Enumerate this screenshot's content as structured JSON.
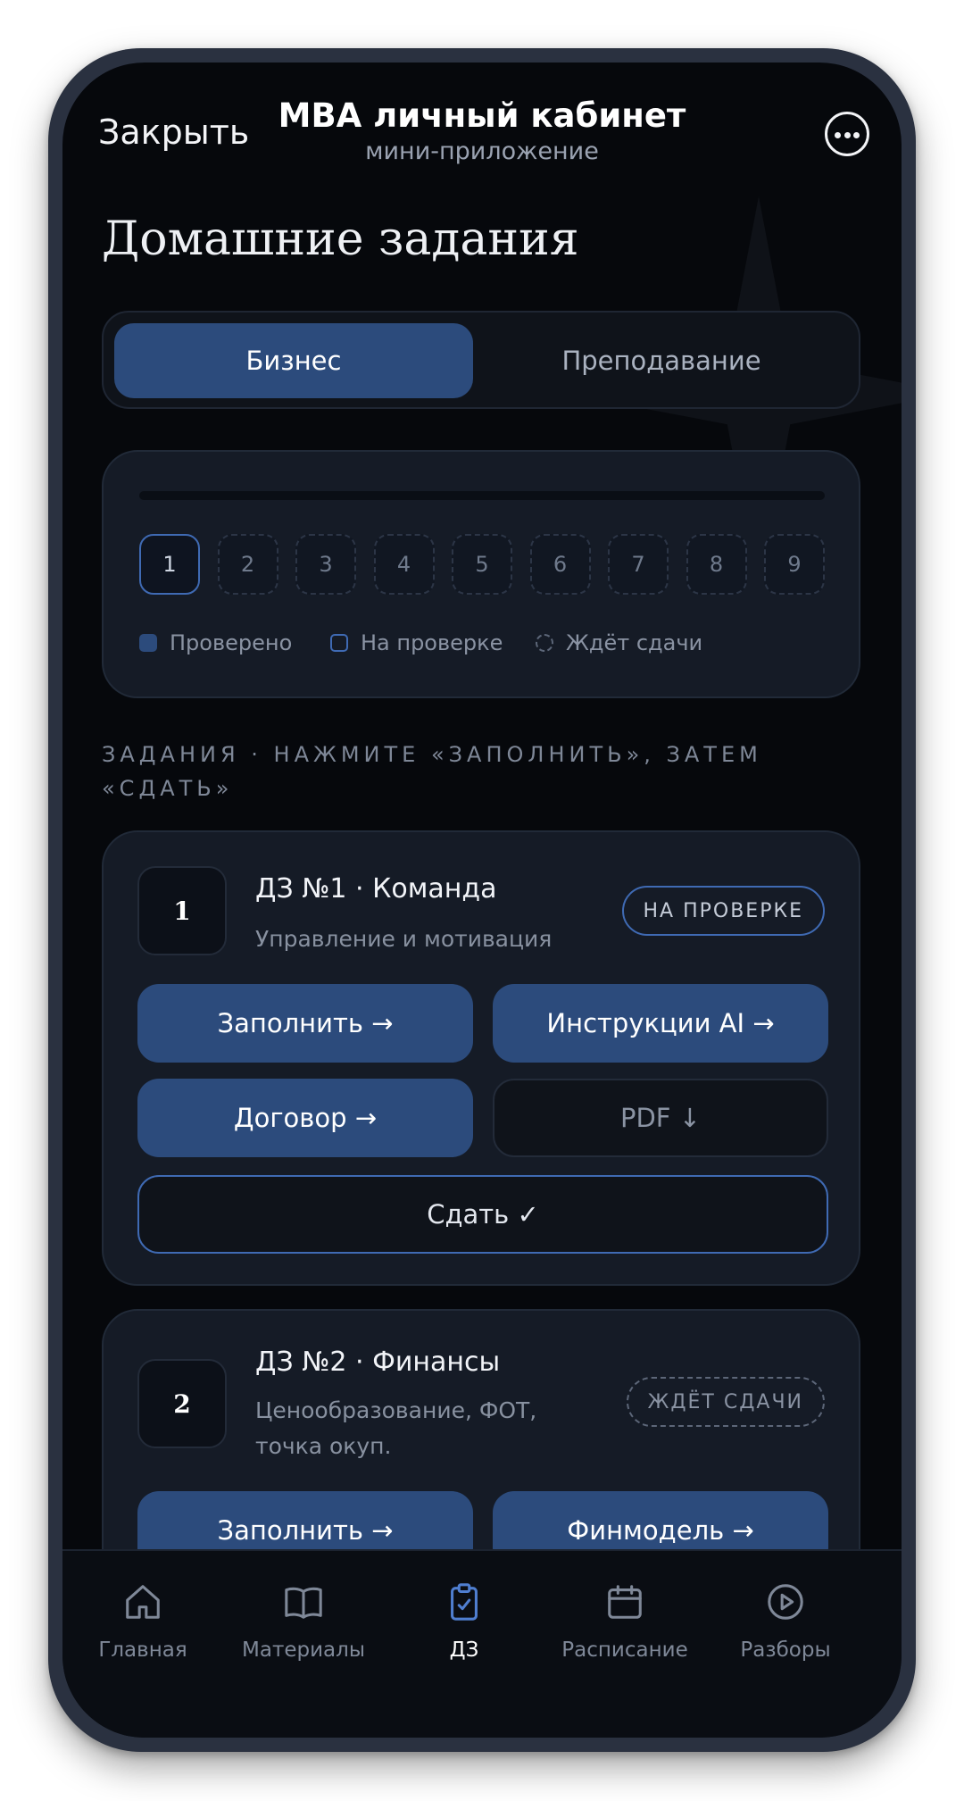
{
  "header": {
    "close_label": "Закрыть",
    "title": "MBA личный кабинет",
    "subtitle": "мини-приложение",
    "more_icon": "more-dots-icon"
  },
  "page_title": "Домашние задания",
  "tabs": [
    {
      "label": "Бизнес",
      "active": true
    },
    {
      "label": "Преподавание",
      "active": false
    }
  ],
  "progress": {
    "steps": [
      "1",
      "2",
      "3",
      "4",
      "5",
      "6",
      "7",
      "8",
      "9"
    ],
    "current_step": "1",
    "legend": [
      "Проверено",
      "На проверке",
      "Ждёт сдачи"
    ]
  },
  "section_label": "ЗАДАНИЯ · НАЖМИТЕ «ЗАПОЛНИТЬ», ЗАТЕМ «СДАТЬ»",
  "tasks": [
    {
      "number": "1",
      "title": "ДЗ №1 · Команда",
      "subtitle": "Управление и мотивация",
      "status": "НА ПРОВЕРКЕ",
      "buttons": {
        "fill": "Заполнить →",
        "ai": "Инструкции AI →",
        "contract": "Договор →",
        "pdf": "PDF ↓",
        "submit": "Сдать ✓"
      }
    },
    {
      "number": "2",
      "title": "ДЗ №2 · Финансы",
      "subtitle": "Ценообразование, ФОТ, точка окуп.",
      "status": "ЖДЁТ СДАЧИ",
      "buttons": {
        "fill": "Заполнить →",
        "finmodel": "Финмодель →"
      }
    }
  ],
  "nav": [
    {
      "label": "Главная",
      "icon": "home-icon"
    },
    {
      "label": "Материалы",
      "icon": "book-icon"
    },
    {
      "label": "ДЗ",
      "icon": "clipboard-check-icon",
      "active": true
    },
    {
      "label": "Расписание",
      "icon": "calendar-icon"
    },
    {
      "label": "Разборы",
      "icon": "play-circle-icon"
    }
  ],
  "colors": {
    "background": "#06080c",
    "card": "#151b26",
    "accent": "#2c4b7c",
    "accent_border": "#3f6ab3"
  }
}
